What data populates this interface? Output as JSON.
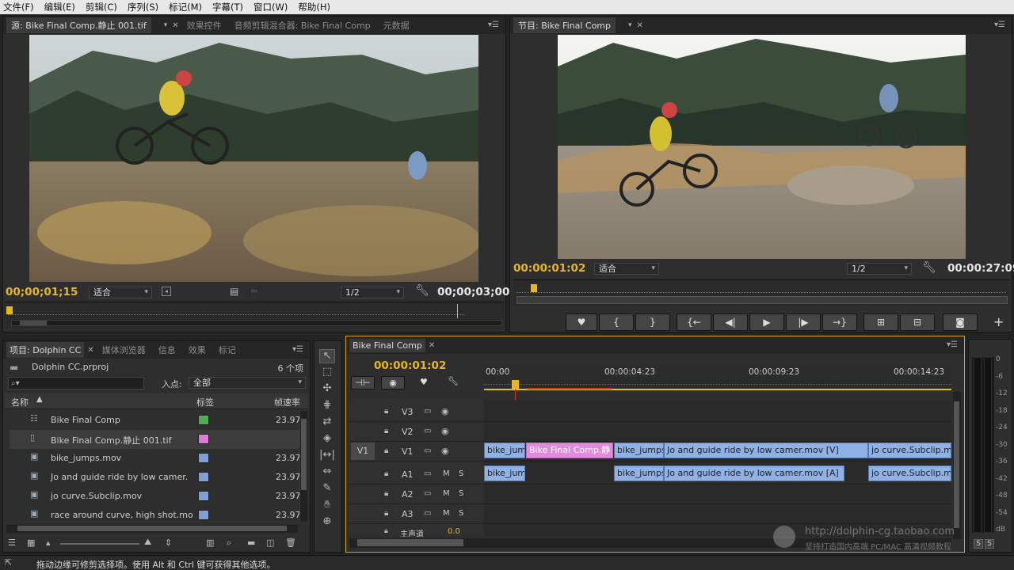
{
  "menu": [
    "文件(F)",
    "编辑(E)",
    "剪辑(C)",
    "序列(S)",
    "标记(M)",
    "字幕(T)",
    "窗口(W)",
    "帮助(H)"
  ],
  "source_panel": {
    "tabs": [
      "源: Bike Final Comp.静止 001.tif",
      "效果控件",
      "音频剪辑混合器: Bike Final Comp",
      "元数据"
    ],
    "timecode_in": "00;00;01;15",
    "fit": "适合",
    "resolution": "1/2",
    "timecode_out": "00;00;03;00"
  },
  "program_panel": {
    "tabs": [
      "节目: Bike Final Comp"
    ],
    "timecode_in": "00:00:01:02",
    "fit": "适合",
    "resolution": "1/2",
    "timecode_out": "00:00:27:09"
  },
  "project_panel": {
    "tabs": [
      "项目: Dolphin CC",
      "媒体浏览器",
      "信息",
      "效果",
      "标记"
    ],
    "project_file": "Dolphin CC.prproj",
    "item_count": "6 个项",
    "search_placeholder": "",
    "in_label": "入点:",
    "in_value": "全部",
    "columns": {
      "name": "名称",
      "label": "标签",
      "fps": "帧速率"
    },
    "items": [
      {
        "name": "Bike Final Comp",
        "label_color": "#4caf50",
        "fps": "23.976",
        "type": "sequence"
      },
      {
        "name": "Bike Final Comp.静止 001.tif",
        "label_color": "#e079d8",
        "fps": "",
        "type": "still"
      },
      {
        "name": "bike_jumps.mov",
        "label_color": "#7f9fd8",
        "fps": "23.976",
        "type": "video"
      },
      {
        "name": "Jo and guide ride by low camer.",
        "label_color": "#7f9fd8",
        "fps": "23.976",
        "type": "video"
      },
      {
        "name": "jo curve.Subclip.mov",
        "label_color": "#7f9fd8",
        "fps": "23.976",
        "type": "video"
      },
      {
        "name": "race around curve, high shot.mo",
        "label_color": "#7f9fd8",
        "fps": "23.976",
        "type": "video"
      }
    ]
  },
  "timeline": {
    "tab": "Bike Final Comp",
    "timecode": "00:00:01:02",
    "ruler_labels": [
      "00:00",
      "00:00:04:23",
      "00:00:09:23",
      "00:00:14:23"
    ],
    "tracks": [
      {
        "id": "V3",
        "kind": "video"
      },
      {
        "id": "V2",
        "kind": "video"
      },
      {
        "id": "V1",
        "kind": "video",
        "source": "V1"
      },
      {
        "id": "A1",
        "kind": "audio"
      },
      {
        "id": "A2",
        "kind": "audio"
      },
      {
        "id": "A3",
        "kind": "audio"
      }
    ],
    "master_label": "主声道",
    "master_value": "0.0",
    "video_clips": [
      "bike_jum",
      "Bike Final Comp.静",
      "bike_jumps",
      "Jo and guide ride by low camer.mov [V]",
      "jo curve.Subclip.mov"
    ],
    "audio_clips": [
      "bike_jum",
      "bike_jumps",
      "Jo and guide ride by low camer.mov [A]",
      "jo curve.Subclip.mov"
    ],
    "track_letters": {
      "m": "M",
      "s": "S"
    }
  },
  "meter": {
    "labels": [
      "0",
      "-6",
      "-12",
      "-18",
      "-24",
      "-30",
      "-36",
      "-42",
      "-48",
      "-54",
      "dB"
    ],
    "solo": [
      "S",
      "S"
    ]
  },
  "status_bar": "拖动边缘可修剪选择项。使用 Alt 和 Ctrl 键可获得其他选项。",
  "watermark": {
    "url": "http://dolphin-cg.taobao.com",
    "line2": "坚持打造国内高端 PC/MAC 高清视频教程"
  }
}
